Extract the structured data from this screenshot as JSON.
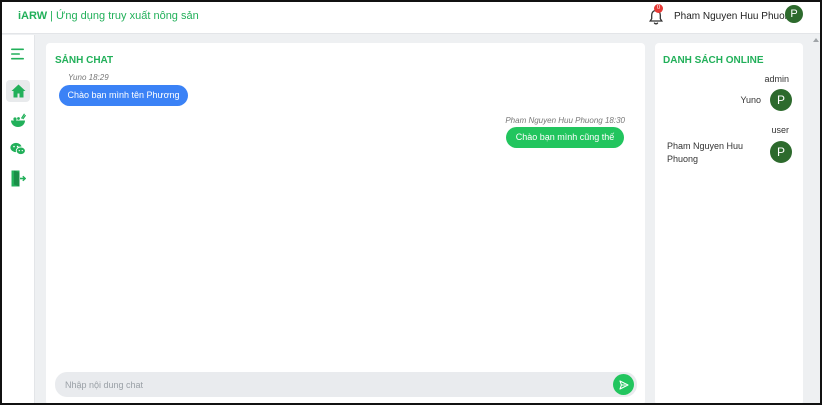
{
  "app": {
    "brand_name": "iARW",
    "separator": "|",
    "subtitle": "Ứng dụng truy xuất nông sản",
    "accent_color": "#22b05a"
  },
  "header": {
    "notification_count": "0",
    "user_name": "Pham Nguyen Huu Phuong",
    "avatar_initial": "P"
  },
  "sidebar": {
    "items": [
      {
        "icon": "menu-icon"
      },
      {
        "icon": "home-icon",
        "active": true
      },
      {
        "icon": "food-bowl-icon"
      },
      {
        "icon": "chat-icon"
      },
      {
        "icon": "logout-icon"
      }
    ]
  },
  "chat": {
    "title": "SẢNH CHAT",
    "messages": [
      {
        "sender": "Yuno",
        "time": "18:29",
        "text": "Chào bạn mình tên Phương",
        "side": "left",
        "color": "#3b82f6"
      },
      {
        "sender": "Pham Nguyen Huu Phuong",
        "time": "18:30",
        "text": "Chào bạn mình cũng thế",
        "side": "right",
        "color": "#22c55e"
      }
    ],
    "input_placeholder": "Nhập nội dung chat",
    "input_value": ""
  },
  "online": {
    "title": "DANH SÁCH ONLINE",
    "groups": [
      {
        "label": "admin",
        "users": [
          {
            "name": "Yuno",
            "initial": "P"
          }
        ]
      },
      {
        "label": "user",
        "users": [
          {
            "name": "Pham Nguyen Huu Phuong",
            "initial": "P"
          }
        ]
      }
    ]
  }
}
